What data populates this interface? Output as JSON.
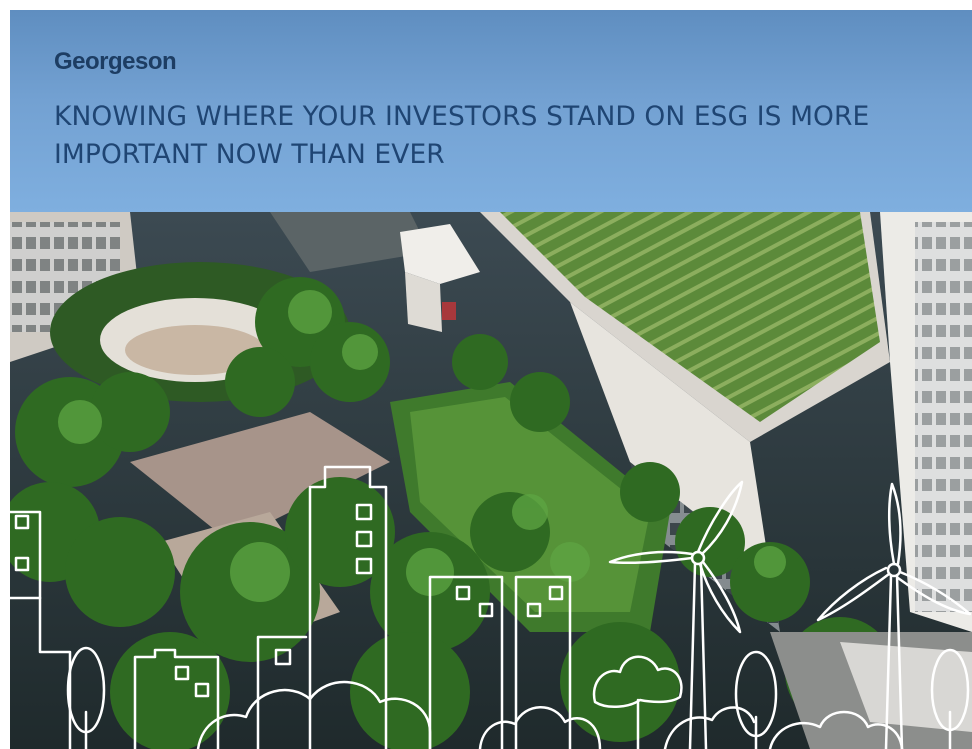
{
  "brand": {
    "name": "Georgeson"
  },
  "headline": {
    "text": "KNOWING WHERE YOUR INVESTORS STAND ON ESG IS MORE IMPORTANT NOW THAN EVER"
  },
  "colors": {
    "header_band": "#73a1d2",
    "brand_text": "#1d3d63",
    "headline_text": "#1f4573",
    "line_art": "#ffffff",
    "foliage": "#3f7a2c",
    "roof": "#6d8f46",
    "building": "#e8e6e2"
  },
  "illustration": {
    "scene": "aerial-green-rooftops",
    "overlay_icons": [
      "wind-turbine-icon",
      "tree-icon",
      "building-outline-icon",
      "cloud-outline-icon"
    ]
  }
}
